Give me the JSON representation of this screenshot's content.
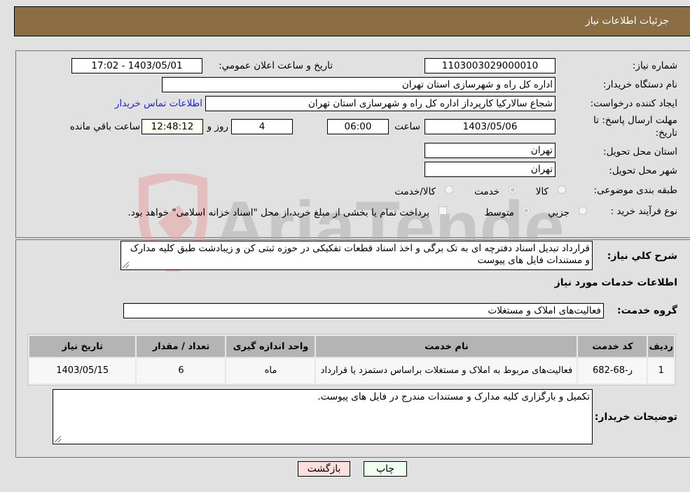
{
  "header": {
    "title": "جزئیات اطلاعات نیاز"
  },
  "fields": {
    "need_number_label": "شماره نیاز:",
    "need_number": "1103003029000010",
    "announce_label": "تاريخ و ساعت اعلان عمومي:",
    "announce_value": "1403/05/01 - 17:02",
    "buyer_org_label": "نام دستگاه خریدار:",
    "buyer_org": "اداره کل راه و شهرسازی استان تهران",
    "creator_label": "ایجاد کننده درخواست:",
    "creator": "شجاع سالارکیا کارپرداز اداره کل راه و شهرسازی استان تهران",
    "contact_link": "اطلاعات تماس خریدار",
    "deadline_label_1": "مهلت ارسال پاسخ: تا",
    "deadline_label_2": "تاریخ:",
    "deadline_date": "1403/05/06",
    "time_label": "ساعت",
    "deadline_time": "06:00",
    "days_value": "4",
    "days_label": "روز و",
    "remaining_time": "12:48:12",
    "remaining_label": "ساعت باقي مانده",
    "province_label": "استان محل تحویل:",
    "province": "تهران",
    "city_label": "شهر محل تحویل:",
    "city": "تهران",
    "category_label": "طبقه بندی موضوعی:",
    "category_options": [
      {
        "label": "کالا",
        "selected": false
      },
      {
        "label": "خدمت",
        "selected": true
      },
      {
        "label": "کالا/خدمت",
        "selected": false
      }
    ],
    "process_label": "نوع فرآیند خرید :",
    "process_options": [
      {
        "label": "جزيي",
        "selected": false
      },
      {
        "label": "متوسط",
        "selected": true
      }
    ],
    "treasury_checkbox_label": "پرداخت تمام یا بخشی از مبلغ خرید،از محل \"اسناد خزانه اسلامی\" خواهد بود.",
    "treasury_checked": false
  },
  "description": {
    "label": "شرح کلي نياز:",
    "text": "قرارداد تبدیل اسناد دفترچه ای به تک برگی و اخذ اسناد قطعات تفکیکی در حوزه ثبتی کن و زیبادشت طبق کلیه مدارک و مستندات فایل های پیوست"
  },
  "services": {
    "section_title": "اطلاعات خدمات مورد نیاز",
    "group_label": "گروه خدمت:",
    "group_value": "فعالیت‌های  املاک و مستغلات",
    "columns": [
      "رديف",
      "کد خدمت",
      "نام خدمت",
      "واحد اندازه گیری",
      "تعداد / مقدار",
      "تاریخ نیاز"
    ],
    "rows": [
      [
        "1",
        "ر-68-682",
        "فعالیت‌های مربوط به املاک و مستغلات براساس دستمزد یا قرارداد",
        "ماه",
        "6",
        "1403/05/15"
      ]
    ]
  },
  "buyer_notes": {
    "label": "توضیحات خریدار:",
    "text": "تکمیل و بارگزاری کلیه مدارک و مستندات مندرج در فایل های پیوست."
  },
  "buttons": {
    "print": "چاپ",
    "back": "بازگشت"
  },
  "colors": {
    "header_bg": "#8b6e44",
    "print_bg": "#efffef",
    "back_bg": "#ffdede",
    "link": "#2323d6"
  },
  "watermark": {
    "text": "AriaTender.neT"
  }
}
